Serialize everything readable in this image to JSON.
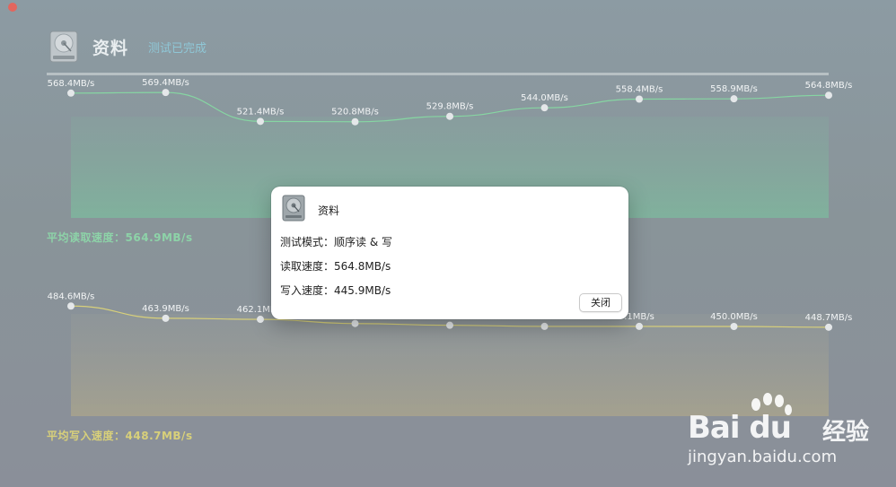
{
  "app": {
    "title": "资料",
    "status": "测试已完成",
    "icon": "hard-disk-icon"
  },
  "read_section": {
    "avg_label": "平均读取速度：",
    "avg_value": "564.9MB/s"
  },
  "write_section": {
    "avg_label": "平均写入速度：",
    "avg_value": "448.7MB/s"
  },
  "colors": {
    "read_line": "#86d6a2",
    "write_line": "#d8d07a",
    "accent_status": "#8fc7d6"
  },
  "chart_data": [
    {
      "type": "area",
      "title": "",
      "unit": "MB/s",
      "x": [
        1,
        2,
        3,
        4,
        5,
        6,
        7,
        8,
        9
      ],
      "values": [
        568.4,
        569.4,
        521.4,
        520.8,
        529.8,
        544.0,
        558.4,
        558.9,
        564.8
      ],
      "labels": [
        "568.4MB/s",
        "569.4MB/s",
        "521.4MB/s",
        "520.8MB/s",
        "529.8MB/s",
        "544.0MB/s",
        "558.4MB/s",
        "558.9MB/s",
        "564.8MB/s"
      ],
      "grid": false
    },
    {
      "type": "area",
      "title": "",
      "unit": "MB/s",
      "x": [
        1,
        2,
        3,
        4,
        5,
        6,
        7,
        8,
        9
      ],
      "values": [
        484.6,
        463.9,
        462.1,
        455.0,
        452.0,
        450.1,
        450.1,
        450.0,
        448.7
      ],
      "labels": [
        "484.6MB/s",
        "463.9MB/s",
        "462.1MB/s",
        "",
        "",
        "",
        ".1MB/s",
        "450.0MB/s",
        "448.7MB/s"
      ],
      "grid": false
    }
  ],
  "dialog": {
    "title": "资料",
    "icon": "hard-disk-icon",
    "mode_line": "测试模式：顺序读 & 写",
    "read_line": "读取速度：564.8MB/s",
    "write_line": "写入速度：445.9MB/s",
    "close_label": "关闭"
  },
  "watermark": {
    "brand": "Bai du",
    "cn": "经验",
    "url": "jingyan.baidu.com"
  }
}
